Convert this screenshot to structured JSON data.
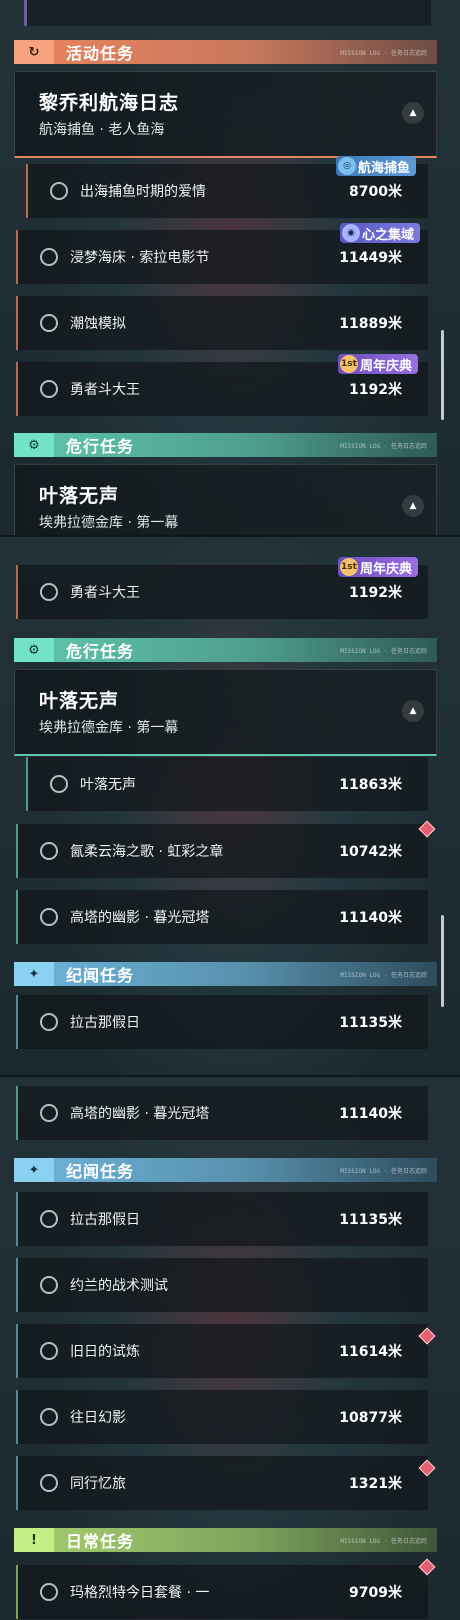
{
  "sections": {
    "activity": {
      "label": "活动任务",
      "icon": "refresh-icon",
      "color": "#e8845f"
    },
    "danger": {
      "label": "危行任务",
      "icon": "gear-icon",
      "color": "#5fc7ad"
    },
    "story": {
      "label": "纪闻任务",
      "icon": "sparkle-icon",
      "color": "#6fb5dc"
    },
    "daily": {
      "label": "日常任务",
      "icon": "alert-icon",
      "color": "#a6d06f"
    }
  },
  "header_deco": "MISSION LOG · 任务日志追踪",
  "groups": {
    "voyage_log": {
      "title": "黎乔利航海日志",
      "subtitle": "航海捕鱼 · 老人鱼海"
    },
    "silent_leaves": {
      "title": "叶落无声",
      "subtitle": "埃弗拉德金库 · 第一幕"
    }
  },
  "badges": {
    "fishing": {
      "label": "航海捕鱼",
      "icon": "fishing-icon"
    },
    "heart": {
      "label": "心之集域",
      "icon": "heart-swirl-icon"
    },
    "anniversary": {
      "label": "周年庆典",
      "icon": "anniversary-1st-icon",
      "mark": "1st"
    }
  },
  "quests": {
    "love": {
      "name": "出海捕鱼时期的爱情",
      "distance": "8700米"
    },
    "dream": {
      "name": "浸梦海床 · 索拉电影节",
      "distance": "11449米"
    },
    "tide": {
      "name": "潮蚀模拟",
      "distance": "11889米"
    },
    "brave": {
      "name": "勇者斗大王",
      "distance": "1192米"
    },
    "leaves": {
      "name": "叶落无声",
      "distance": "11863米"
    },
    "cloud": {
      "name": "氤柔云海之歌 · 虹彩之章",
      "distance": "10742米"
    },
    "tower": {
      "name": "高塔的幽影 · 暮光冠塔",
      "distance": "11140米"
    },
    "lagu": {
      "name": "拉古那假日",
      "distance": "11135米"
    },
    "john": {
      "name": "约兰的战术测试",
      "distance": ""
    },
    "trial": {
      "name": "旧日的试炼",
      "distance": "11614米"
    },
    "phantom": {
      "name": "往日幻影",
      "distance": "10877米"
    },
    "journey": {
      "name": "同行忆旅",
      "distance": "1321米"
    },
    "margo": {
      "name": "玛格烈特今日套餐 · 一",
      "distance": "9709米"
    }
  }
}
